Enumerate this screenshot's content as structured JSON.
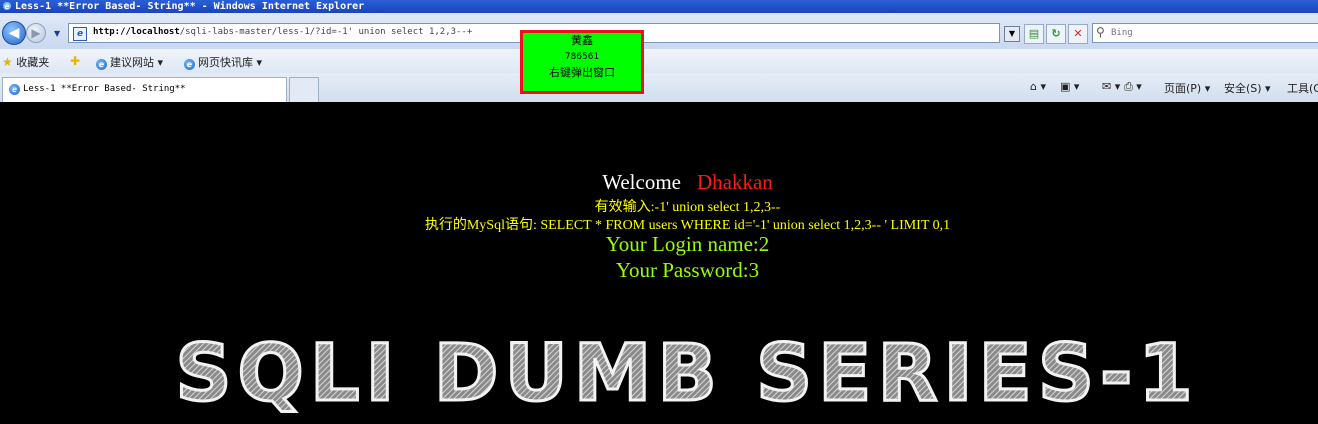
{
  "window": {
    "title": "Less-1 **Error Based- String** - Windows Internet Explorer"
  },
  "address_bar": {
    "url_host": "http://localhost",
    "url_path": "/sqli-labs-master/less-1/?id=-1' union select 1,2,3--+",
    "search_placeholder": "Bing"
  },
  "favorites_bar": {
    "favorites_label": "收藏夹",
    "suggested_sites": "建议网站 ▾",
    "web_slice": "网页快讯库 ▾"
  },
  "tabs": [
    {
      "label": "Less-1 **Error Based- String**"
    }
  ],
  "command_bar": {
    "page_menu": "页面(P) ▾",
    "safety_menu": "安全(S) ▾",
    "tools_menu": "工具(O)"
  },
  "overlay": {
    "name": "黄鑫",
    "number": "786561",
    "action": "右键弹出窗口"
  },
  "page": {
    "welcome": "Welcome",
    "user": "Dhakkan",
    "valid_input": "有效输入:-1' union select 1,2,3--",
    "sql_statement": "执行的MySql语句: SELECT * FROM users WHERE id='-1' union select 1,2,3-- ' LIMIT 0,1",
    "login_name": "Your Login name:2",
    "password": "Your Password:3",
    "banner": "SQLI DUMB SERIES-1"
  },
  "colors": {
    "popup_bg": "#00ff00",
    "popup_border": "#e8141b",
    "user_name": "#ff1a1a",
    "query_text": "#ffff00",
    "result_text": "#99ff00"
  }
}
